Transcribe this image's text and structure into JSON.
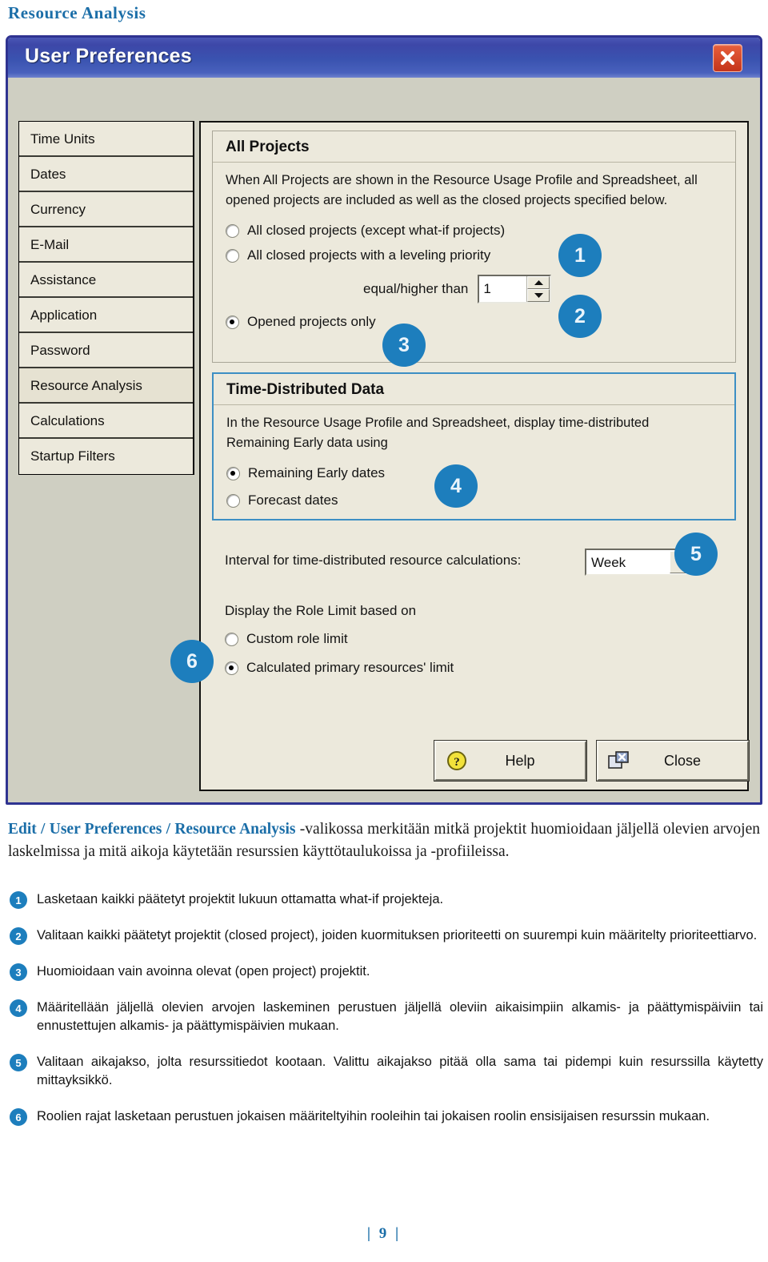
{
  "page": {
    "heading": "Resource Analysis",
    "page_number": "| 9 |",
    "accent_blue": "#1d7ebd",
    "titlebar_blue": "#3a53b0"
  },
  "dialog": {
    "title": "User Preferences",
    "close_icon": "close-x-icon",
    "sidebar": {
      "items": [
        {
          "label": "Time Units",
          "selected": false
        },
        {
          "label": "Dates",
          "selected": false
        },
        {
          "label": "Currency",
          "selected": false
        },
        {
          "label": "E-Mail",
          "selected": false
        },
        {
          "label": "Assistance",
          "selected": false
        },
        {
          "label": "Application",
          "selected": false
        },
        {
          "label": "Password",
          "selected": false
        },
        {
          "label": "Resource Analysis",
          "selected": true
        },
        {
          "label": "Calculations",
          "selected": false
        },
        {
          "label": "Startup Filters",
          "selected": false
        }
      ]
    },
    "all_projects": {
      "title": "All Projects",
      "description": "When All Projects are shown in the Resource Usage Profile and Spreadsheet, all opened projects are included as well as the closed projects specified below.",
      "options": [
        {
          "label": "All closed projects (except what-if projects)",
          "checked": false
        },
        {
          "label": "All closed projects with a leveling priority",
          "checked": false
        },
        {
          "label": "Opened projects only",
          "checked": true
        }
      ],
      "priority_label": "equal/higher than",
      "priority_value": "1"
    },
    "time_distributed": {
      "title": "Time-Distributed Data",
      "description": "In the Resource Usage Profile and Spreadsheet, display time-distributed Remaining Early data using",
      "options": [
        {
          "label": "Remaining Early dates",
          "checked": true
        },
        {
          "label": "Forecast dates",
          "checked": false
        }
      ]
    },
    "interval": {
      "label": "Interval for time-distributed resource calculations:",
      "value": "Week"
    },
    "role_limit": {
      "label": "Display the Role Limit based on",
      "options": [
        {
          "label": "Custom role limit",
          "checked": false
        },
        {
          "label": "Calculated primary resources' limit",
          "checked": true
        }
      ]
    },
    "buttons": [
      {
        "label": "Help",
        "icon": "help-question-icon"
      },
      {
        "label": "Close",
        "icon": "close-window-icon"
      }
    ],
    "callouts": [
      "1",
      "2",
      "3",
      "4",
      "5",
      "6"
    ]
  },
  "caption": {
    "lead": "Edit / User Preferences / Resource Analysis",
    "rest": " -valikossa merkitään mitkä projektit huomioidaan jäljellä olevien arvojen laskelmissa ja mitä aikoja käytetään resurssien käyttötaulukoissa ja -profiileissa."
  },
  "notes": [
    {
      "num": "1",
      "text": "Lasketaan kaikki päätetyt projektit lukuun ottamatta what-if projekteja."
    },
    {
      "num": "2",
      "text": "Valitaan kaikki päätetyt projektit (closed project), joiden kuormituksen prioriteetti on suurempi kuin määritelty prioriteettiarvo."
    },
    {
      "num": "3",
      "text": "Huomioidaan vain avoinna olevat (open project) projektit."
    },
    {
      "num": "4",
      "text": "Määritellään jäljellä olevien arvojen laskeminen perustuen jäljellä oleviin aikaisimpiin alkamis- ja päättymispäiviin tai ennustettujen alkamis- ja päättymispäivien mukaan."
    },
    {
      "num": "5",
      "text": "Valitaan aikajakso, jolta resurssitiedot kootaan. Valittu aikajakso pitää olla sama tai pidempi kuin resurssilla käytetty mittayksikkö."
    },
    {
      "num": "6",
      "text": "Roolien rajat lasketaan perustuen jokaisen määriteltyihin rooleihin tai jokaisen roolin ensisijaisen resurssin mukaan."
    }
  ]
}
